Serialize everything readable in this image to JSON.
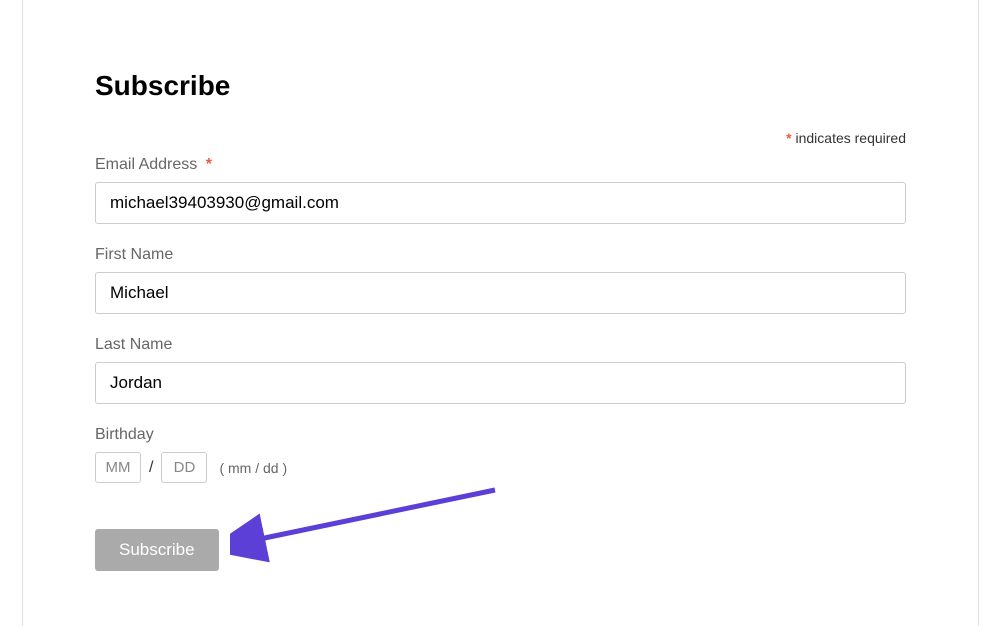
{
  "title": "Subscribe",
  "required_note": "indicates required",
  "asterisk": "*",
  "fields": {
    "email": {
      "label": "Email Address",
      "value": "michael39403930@gmail.com",
      "required": true
    },
    "first_name": {
      "label": "First Name",
      "value": "Michael"
    },
    "last_name": {
      "label": "Last Name",
      "value": "Jordan"
    },
    "birthday": {
      "label": "Birthday",
      "month_placeholder": "MM",
      "day_placeholder": "DD",
      "separator": "/",
      "hint": "( mm / dd )"
    }
  },
  "submit_label": "Subscribe",
  "colors": {
    "accent_required": "#e85c41",
    "button_bg": "#aaaaaa",
    "arrow": "#5b3fd6"
  }
}
